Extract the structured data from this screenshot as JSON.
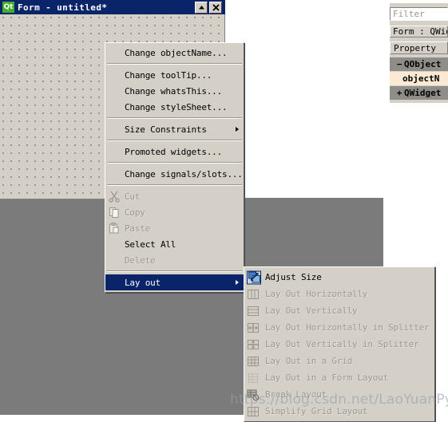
{
  "form_window": {
    "title": "Form - untitled*",
    "logo_text": "Qt",
    "maximize_button": "▲",
    "close_button": "✕"
  },
  "context_menu": {
    "items": [
      {
        "label": "Change objectName...",
        "state": "enabled",
        "icon": "",
        "submenu": false
      },
      {
        "label": "__SEP__",
        "state": "separator",
        "icon": "",
        "submenu": false
      },
      {
        "label": "Change toolTip...",
        "state": "enabled",
        "icon": "",
        "submenu": false
      },
      {
        "label": "Change whatsThis...",
        "state": "enabled",
        "icon": "",
        "submenu": false
      },
      {
        "label": "Change styleSheet...",
        "state": "enabled",
        "icon": "",
        "submenu": false
      },
      {
        "label": "__SEP__",
        "state": "separator",
        "icon": "",
        "submenu": false
      },
      {
        "label": "Size Constraints",
        "state": "enabled",
        "icon": "",
        "submenu": true
      },
      {
        "label": "__SEP__",
        "state": "separator",
        "icon": "",
        "submenu": false
      },
      {
        "label": "Promoted widgets...",
        "state": "enabled",
        "icon": "",
        "submenu": false
      },
      {
        "label": "__SEP__",
        "state": "separator",
        "icon": "",
        "submenu": false
      },
      {
        "label": "Change signals/slots...",
        "state": "enabled",
        "icon": "",
        "submenu": false
      },
      {
        "label": "__SEP__",
        "state": "separator",
        "icon": "",
        "submenu": false
      },
      {
        "label": "Cut",
        "state": "disabled",
        "icon": "scissors-icon",
        "submenu": false
      },
      {
        "label": "Copy",
        "state": "disabled",
        "icon": "copy-pages-icon",
        "submenu": false
      },
      {
        "label": "Paste",
        "state": "disabled",
        "icon": "paste-clipboard-icon",
        "submenu": false
      },
      {
        "label": "Select All",
        "state": "enabled",
        "icon": "",
        "submenu": false
      },
      {
        "label": "Delete",
        "state": "disabled",
        "icon": "",
        "submenu": false
      },
      {
        "label": "__SEP__",
        "state": "separator",
        "icon": "",
        "submenu": false
      },
      {
        "label": "Lay out",
        "state": "highlighted",
        "icon": "",
        "submenu": true
      }
    ]
  },
  "layout_submenu": {
    "items": [
      {
        "label": "Adjust Size",
        "state": "enabled",
        "icon": "adjust-size-icon"
      },
      {
        "label": "Lay Out Horizontally",
        "state": "disabled",
        "icon": "layout-horizontal-icon"
      },
      {
        "label": "Lay Out Vertically",
        "state": "disabled",
        "icon": "layout-vertical-icon"
      },
      {
        "label": "Lay Out Horizontally in Splitter",
        "state": "disabled",
        "icon": "splitter-horizontal-icon"
      },
      {
        "label": "Lay Out Vertically in Splitter",
        "state": "disabled",
        "icon": "splitter-vertical-icon"
      },
      {
        "label": "Lay Out in a Grid",
        "state": "disabled",
        "icon": "layout-grid-icon"
      },
      {
        "label": "Lay Out in a Form Layout",
        "state": "disabled",
        "icon": "layout-form-icon"
      },
      {
        "label": "Break Layout",
        "state": "disabled",
        "icon": "break-layout-icon"
      },
      {
        "label": "Simplify Grid Layout",
        "state": "disabled",
        "icon": "simplify-grid-icon"
      }
    ]
  },
  "property_editor": {
    "filter_placeholder": "Filter",
    "object_header": "Form : QWidg",
    "column_header": "Property",
    "rows": [
      {
        "twisty": "−",
        "label": "QObject",
        "kind": "group"
      },
      {
        "twisty": "",
        "label": "objectN",
        "kind": "prop"
      },
      {
        "twisty": "+",
        "label": "QWidget",
        "kind": "group"
      }
    ]
  },
  "watermark": {
    "text": "https://blog.csdn.net/LaoYuanPython"
  }
}
